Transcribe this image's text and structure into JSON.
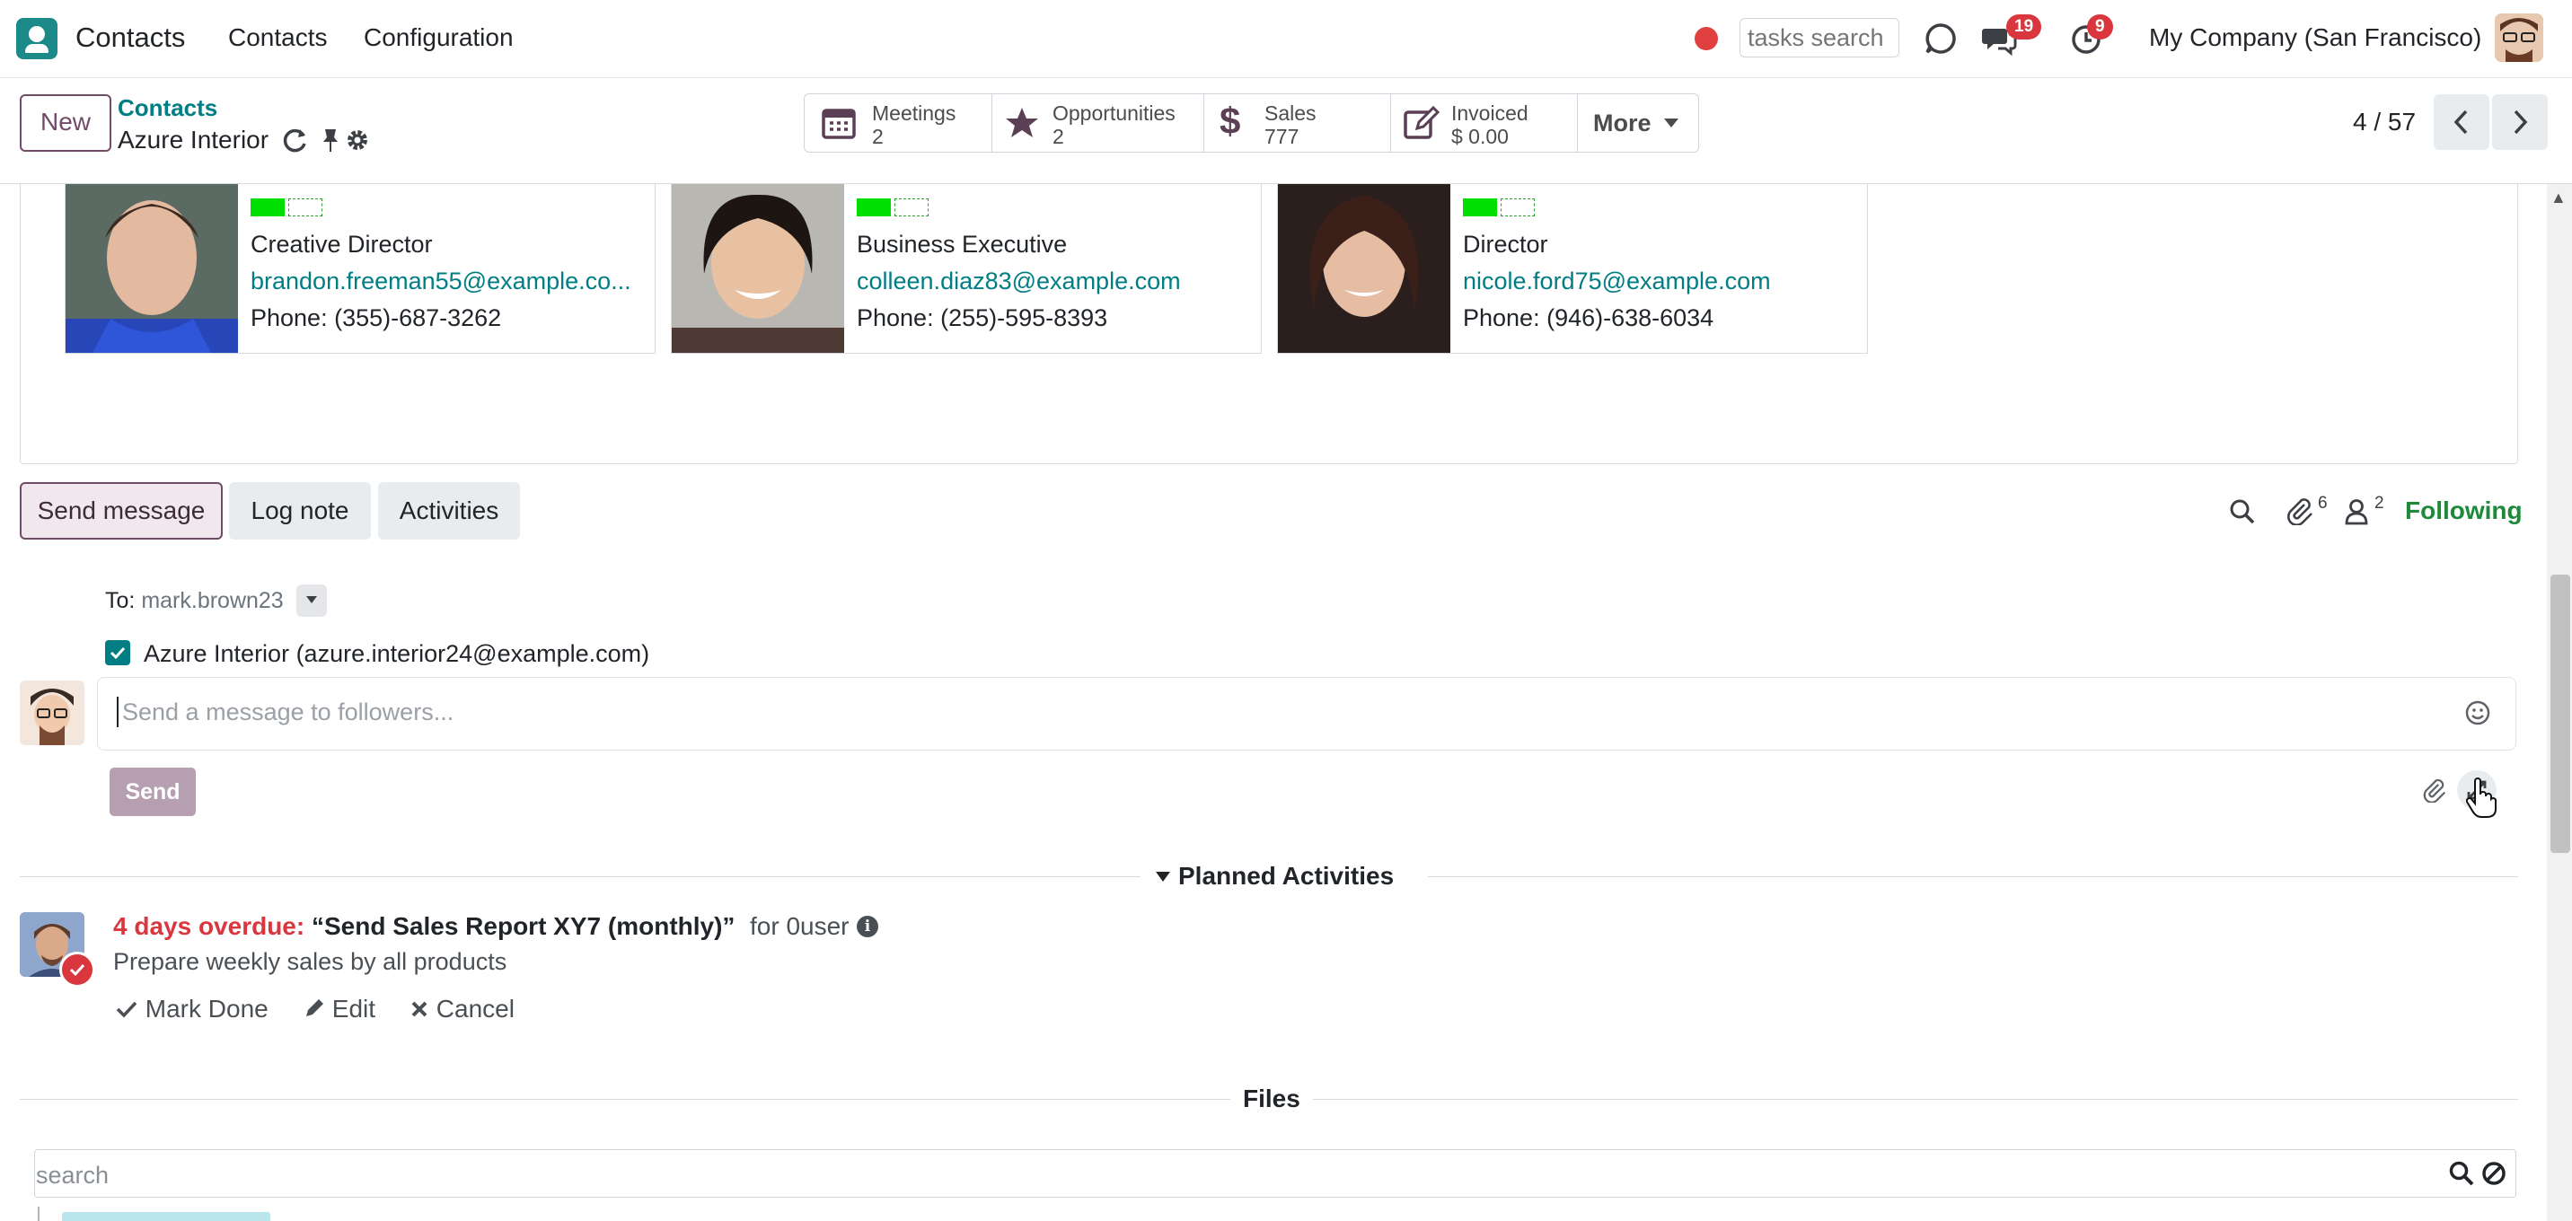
{
  "navbar": {
    "app_name": "Contacts",
    "menu": [
      "Contacts",
      "Configuration"
    ],
    "tasks_search_placeholder": "tasks search",
    "messages_count": "19",
    "activities_count": "9",
    "company": "My Company (San Francisco)"
  },
  "control_panel": {
    "new_label": "New",
    "breadcrumb_parent": "Contacts",
    "breadcrumb_current": "Azure Interior",
    "smart_buttons": [
      {
        "label": "Meetings",
        "value": "2",
        "icon": "calendar-icon"
      },
      {
        "label": "Opportunities",
        "value": "2",
        "icon": "star-icon"
      },
      {
        "label": "Sales",
        "value": "777",
        "icon": "dollar-icon"
      },
      {
        "label": "Invoiced",
        "value": "$ 0.00",
        "icon": "edit-icon"
      }
    ],
    "more_label": "More",
    "pager": "4 / 57"
  },
  "contacts": [
    {
      "role": "Creative Director",
      "email": "brandon.freeman55@example.co...",
      "phone": "Phone: (355)-687-3262"
    },
    {
      "role": "Business Executive",
      "email": "colleen.diaz83@example.com",
      "phone": "Phone: (255)-595-8393"
    },
    {
      "role": "Director",
      "email": "nicole.ford75@example.com",
      "phone": "Phone: (946)-638-6034"
    }
  ],
  "chatter": {
    "send_message": "Send message",
    "log_note": "Log note",
    "activities": "Activities",
    "attachments_count": "6",
    "followers_count": "2",
    "following": "Following",
    "to_label": "To:",
    "to_name": "mark.brown23",
    "recipient": "Azure Interior (azure.interior24@example.com)",
    "composer_placeholder": "Send a message to followers...",
    "send": "Send"
  },
  "planned": {
    "title": "Planned Activities",
    "overdue": "4 days overdue:",
    "summary": "“Send Sales Report XY7 (monthly)”",
    "for_user": "for 0user",
    "note": "Prepare weekly sales by all products",
    "mark_done": "Mark Done",
    "edit": "Edit",
    "cancel": "Cancel"
  },
  "files": {
    "title": "Files",
    "search_placeholder": "search"
  },
  "colors": {
    "brand": "#714b67",
    "teal": "#017e84",
    "overdue": "#d9363e",
    "following": "#1d8a3a"
  }
}
